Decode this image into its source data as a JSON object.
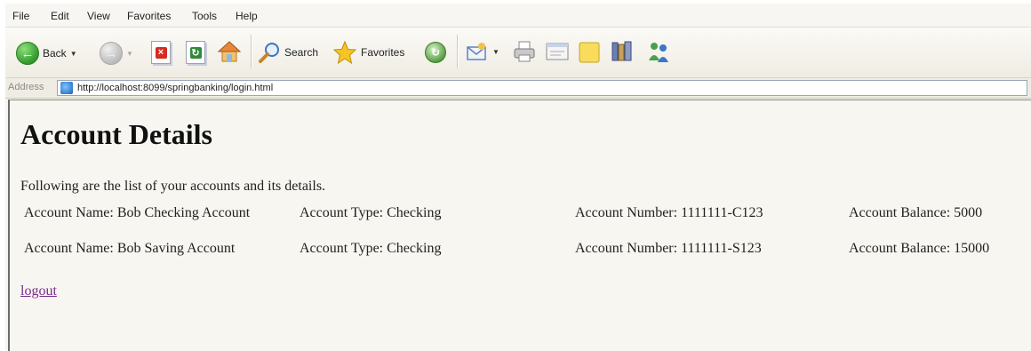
{
  "menu": [
    "File",
    "Edit",
    "View",
    "Favorites",
    "Tools",
    "Help"
  ],
  "toolbar": {
    "back_label": "Back",
    "search_label": "Search",
    "favorites_label": "Favorites"
  },
  "address": {
    "label": "Address",
    "url": "http://localhost:8099/springbanking/login.html"
  },
  "page": {
    "title": "Account Details",
    "intro": "Following are the list of your accounts and its details.",
    "accounts": [
      {
        "name": "Account Name: Bob Checking Account",
        "type": "Account Type: Checking",
        "number": "Account Number: 1111111-C123",
        "balance": "Account Balance: 5000"
      },
      {
        "name": "Account Name: Bob Saving Account",
        "type": "Account Type: Checking",
        "number": "Account Number: 1111111-S123",
        "balance": "Account Balance: 15000"
      }
    ],
    "logout_label": "logout"
  },
  "colors": {
    "link_visited": "#7a2b8f",
    "page_bg": "#f7f6f1"
  }
}
